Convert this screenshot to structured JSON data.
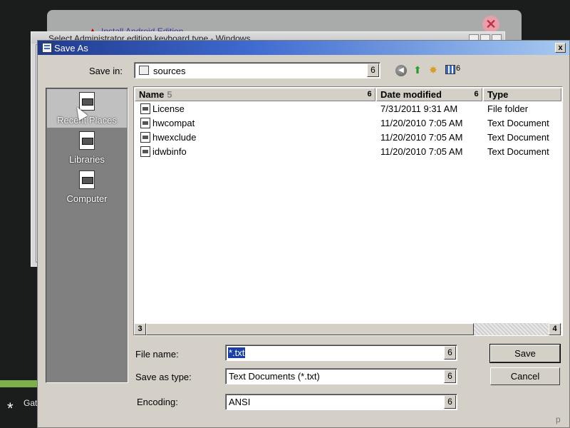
{
  "background": {
    "back_window_title": "Install Android Edition",
    "mid_window_title": "Select Administrator edition keyboard type - Windows",
    "taskbar_text": "Gat",
    "star_glyph": "*",
    "close_glyph": "✕"
  },
  "dialog": {
    "title": "Save As",
    "close_glyph": "x",
    "save_in_label": "Save in:",
    "save_in_value": "sources",
    "dropdown_glyph": "6",
    "toolbar": {
      "back_icon": "back-arrow-icon",
      "up_icon": "up-folder-icon",
      "new_folder_icon": "new-folder-icon",
      "view_icon": "view-menu-icon",
      "view_arrow": "6"
    },
    "places": [
      {
        "label": "Recent Places",
        "icon": "recent-places-icon"
      },
      {
        "label": "Libraries",
        "icon": "libraries-icon"
      },
      {
        "label": "Computer",
        "icon": "computer-icon"
      }
    ],
    "columns": {
      "name": "Name",
      "name_sort_marker": "5",
      "date": "Date modified",
      "type": "Type",
      "split_marker": "6"
    },
    "files": [
      {
        "name": "License",
        "date": "7/31/2011 9:31 AM",
        "type": "File folder"
      },
      {
        "name": "hwcompat",
        "date": "11/20/2010 7:05 AM",
        "type": "Text Document"
      },
      {
        "name": "hwexclude",
        "date": "11/20/2010 7:05 AM",
        "type": "Text Document"
      },
      {
        "name": "idwbinfo",
        "date": "11/20/2010 7:05 AM",
        "type": "Text Document"
      }
    ],
    "scrollbar": {
      "left_glyph": "3",
      "right_glyph": "4"
    },
    "file_name_label": "File name:",
    "file_name_value": "*.txt",
    "save_as_type_label": "Save as type:",
    "save_as_type_value": "Text Documents (*.txt)",
    "encoding_label": "Encoding:",
    "encoding_value": "ANSI",
    "save_button": "Save",
    "cancel_button": "Cancel",
    "resize_grip": "p"
  },
  "colors": {
    "titlebar_start": "#1f3a8c",
    "titlebar_end": "#a6caf0",
    "selection": "#1b3fa8",
    "dialog_face": "#d4d0c8"
  }
}
